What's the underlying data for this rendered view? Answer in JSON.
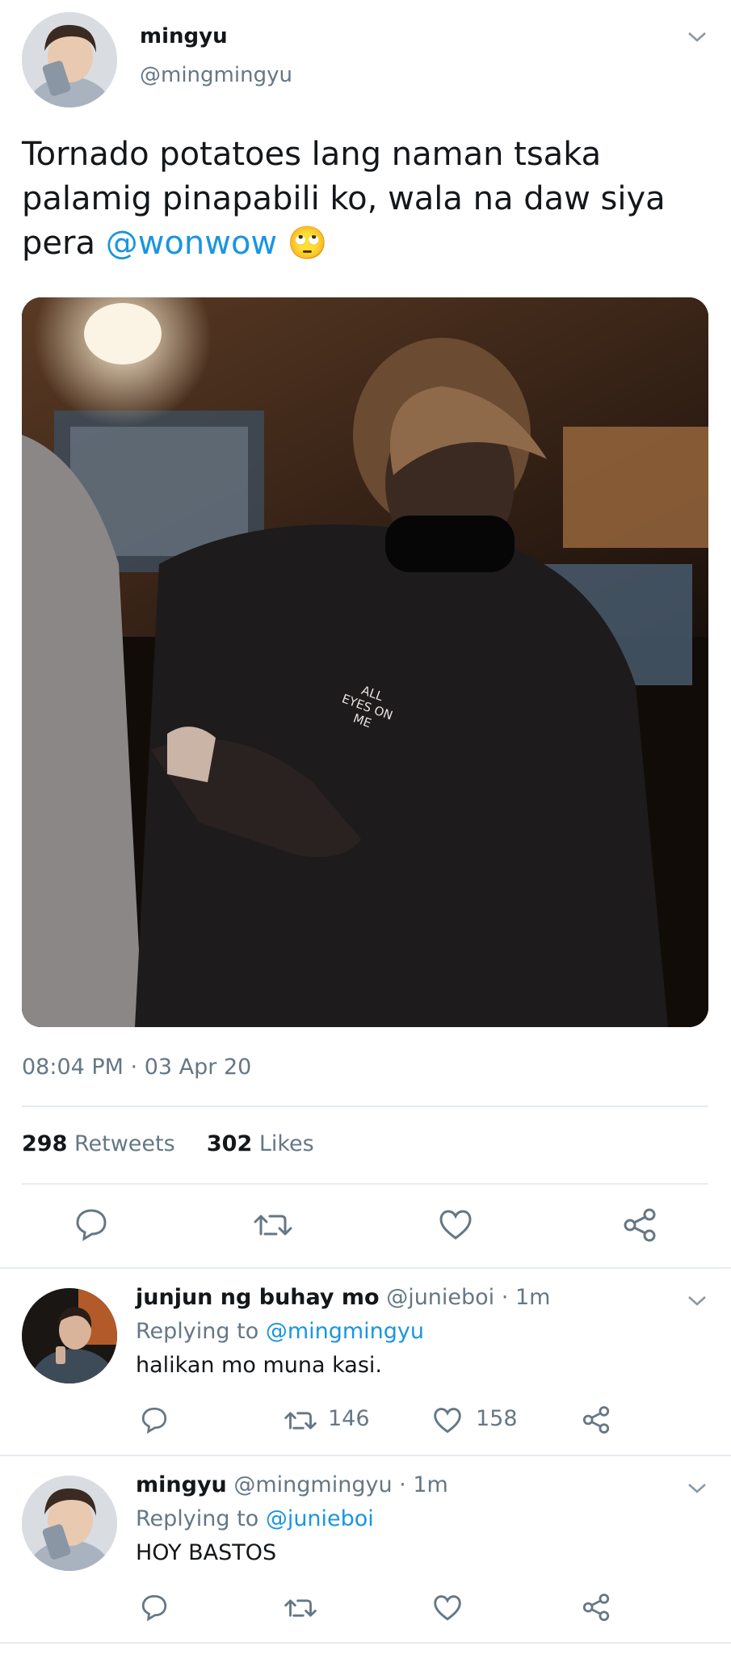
{
  "main_tweet": {
    "author_name": "mingyu",
    "author_handle": "@mingmingyu",
    "text_line1": "Tornado potatoes lang naman tsaka",
    "text_line2": "palamig pinapabili ko, wala na daw siya",
    "text_line3_prefix": "pera",
    "text_mention": "@wonwow",
    "emoji": "🙄",
    "image_text": [
      "ALL",
      "EYES ON",
      "ME"
    ],
    "timestamp": "08:04 PM · 03 Apr 20",
    "retweets_count": "298",
    "retweets_label": "Retweets",
    "likes_count": "302",
    "likes_label": "Likes"
  },
  "replies": [
    {
      "author_name": "junjun ng buhay mo",
      "author_handle": "@junieboi",
      "time": "· 1m",
      "replying_label": "Replying to",
      "replying_to": "@mingmingyu",
      "text": "halikan mo muna kasi.",
      "retweets": "146",
      "likes": "158"
    },
    {
      "author_name": "mingyu",
      "author_handle": "@mingmingyu",
      "time": "· 1m",
      "replying_label": "Replying to",
      "replying_to": "@junieboi",
      "text": "HOY BASTOS",
      "retweets": "",
      "likes": ""
    }
  ],
  "icons": {
    "reply": "reply-icon",
    "retweet": "retweet-icon",
    "like": "heart-icon",
    "share": "share-icon",
    "more": "chevron-down-icon"
  },
  "colors": {
    "link": "#1b95e0",
    "muted": "#657786",
    "divider": "#e6ecf0"
  }
}
